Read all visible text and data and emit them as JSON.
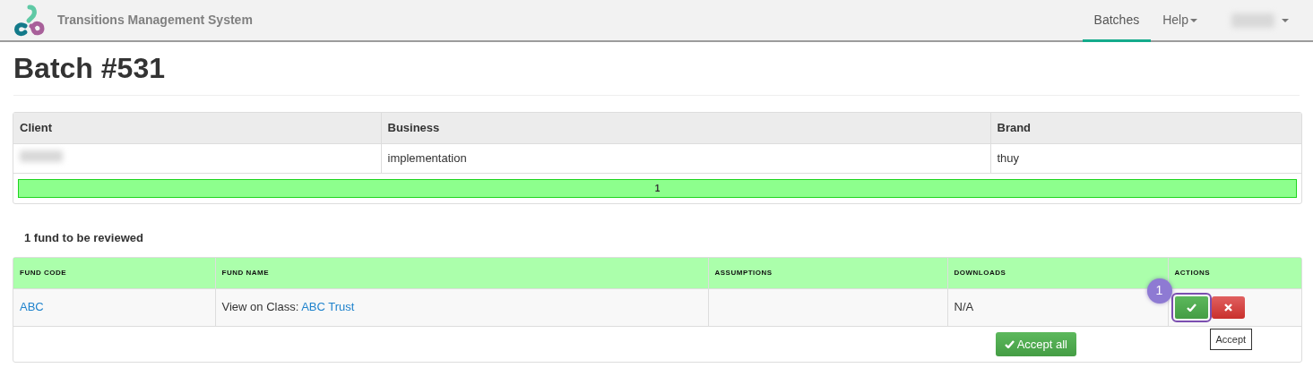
{
  "navbar": {
    "brand": "Transitions Management System",
    "items": [
      {
        "label": "Batches",
        "selected": true,
        "kind": "link"
      },
      {
        "label": "Help",
        "selected": false,
        "kind": "dropdown"
      },
      {
        "selected": false,
        "kind": "user"
      }
    ]
  },
  "title": "Batch #531",
  "summary": {
    "columns": [
      "Client",
      "Business",
      "Brand"
    ],
    "row": [
      {
        "kind": "redacted"
      },
      {
        "kind": "text",
        "text": "implementation"
      },
      {
        "kind": "text",
        "text": "thuy"
      }
    ],
    "progress": {
      "level": 1,
      "label": "1"
    }
  },
  "review_heading": "1 fund to be reviewed",
  "funds": {
    "columns": [
      "FUND CODE",
      "FUND NAME",
      "ASSUMPTIONS",
      "DOWNLOADS",
      "ACTIONS"
    ],
    "rows": [
      {
        "code": "ABC",
        "name_prefix": "View on Class: ",
        "name_link": "ABC Trust",
        "downloads": "N/A"
      }
    ],
    "accept_all": "Accept all"
  },
  "callout": {
    "number": "1",
    "tooltip": "Accept"
  }
}
